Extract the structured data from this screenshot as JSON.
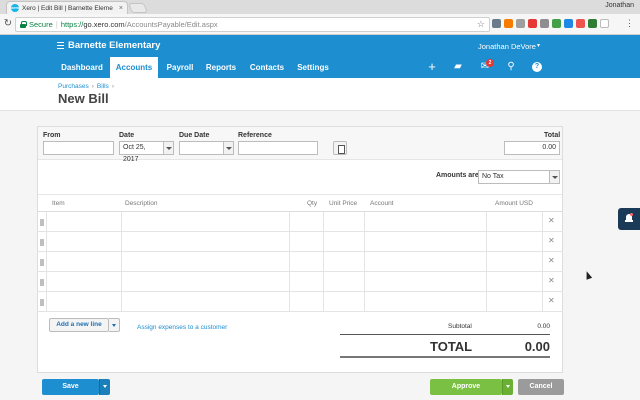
{
  "browser": {
    "tab_title": "Xero | Edit Bill | Barnette Eleme",
    "tab_close": "×",
    "favicon_text": "xero",
    "profile": "Jonathan",
    "secure_label": "Secure",
    "url_scheme": "https://",
    "url_host": "go.xero.com",
    "url_path": "/AccountsPayable/Edit.aspx"
  },
  "header": {
    "org_name": "Barnette Elementary",
    "user_name": "Jonathan DeVore",
    "notification_count": "2"
  },
  "nav": {
    "items": [
      {
        "label": "Dashboard"
      },
      {
        "label": "Accounts"
      },
      {
        "label": "Payroll"
      },
      {
        "label": "Reports"
      },
      {
        "label": "Contacts"
      },
      {
        "label": "Settings"
      }
    ],
    "active": "Accounts"
  },
  "page": {
    "breadcrumb": [
      "Purchases",
      "Bills"
    ],
    "title": "New Bill"
  },
  "form": {
    "from_label": "From",
    "from_value": "",
    "date_label": "Date",
    "date_value": "Oct 25, 2017",
    "due_label": "Due Date",
    "due_value": "",
    "ref_label": "Reference",
    "ref_value": "",
    "total_label": "Total",
    "total_value": "0.00",
    "amounts_are_label": "Amounts are",
    "amounts_are_value": "No Tax"
  },
  "lines": {
    "columns": [
      "Item",
      "Description",
      "Qty",
      "Unit Price",
      "Account",
      "Amount USD"
    ],
    "row_count": 5,
    "remove_glyph": "✕"
  },
  "actions": {
    "add_line": "Add a new line",
    "assign_link": "Assign expenses to a customer",
    "subtotal_label": "Subtotal",
    "subtotal_value": "0.00",
    "total_label": "TOTAL",
    "total_value": "0.00",
    "save": "Save",
    "approve": "Approve",
    "cancel": "Cancel"
  },
  "colors": {
    "xero_blue": "#1d8ecf",
    "approve_green": "#7ac143",
    "save_blue": "#1d8ecf",
    "cancel_gray": "#9b9b9b"
  }
}
